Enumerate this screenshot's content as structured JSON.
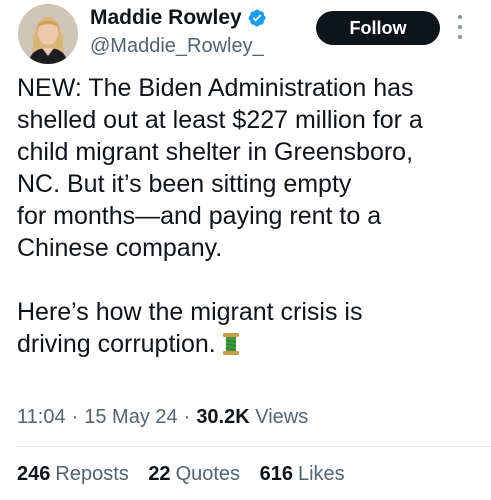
{
  "author": {
    "display_name": "Maddie Rowley",
    "handle": "@Maddie_Rowley_",
    "verified_icon": "verified-badge-icon",
    "verified_color": "#1d9bf0"
  },
  "actions": {
    "follow_label": "Follow",
    "more_icon": "more-vertical-icon"
  },
  "tweet": {
    "text": "NEW: The Biden Administration has\nshelled out at least $227 million for a\nchild migrant shelter in Greensboro,\nNC. But it’s been sitting empty\nfor months—and paying rent to a\nChinese company.\n\nHere’s how the migrant crisis is\ndriving corruption.",
    "emoji_icon": "thread-spool-icon"
  },
  "meta": {
    "time": "11:04",
    "date": "15 May 24",
    "views_count": "30.2K",
    "views_label": "Views",
    "separator": "·"
  },
  "stats": {
    "reposts_count": "246",
    "reposts_label": "Reposts",
    "quotes_count": "22",
    "quotes_label": "Quotes",
    "likes_count": "616",
    "likes_label": "Likes"
  },
  "colors": {
    "text_primary": "#0f1419",
    "text_secondary": "#536471",
    "button_bg": "#0f1419",
    "button_text": "#ffffff"
  }
}
